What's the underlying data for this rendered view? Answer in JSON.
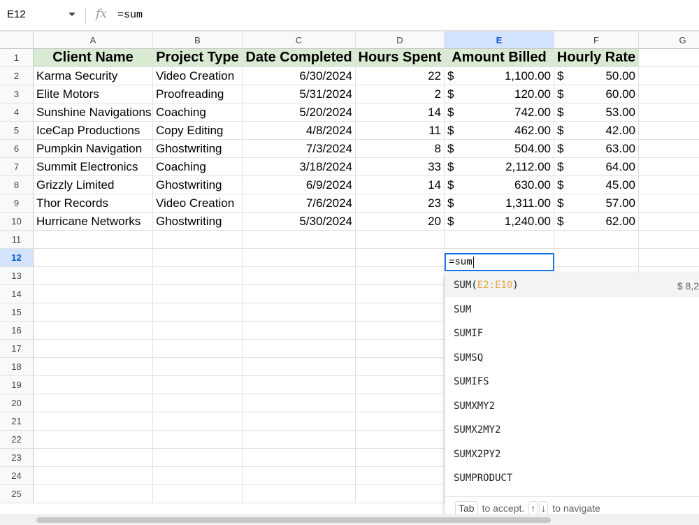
{
  "formula_bar": {
    "name_box": "E12",
    "fx_label": "fx",
    "formula": "=sum"
  },
  "columns": [
    "A",
    "B",
    "C",
    "D",
    "E",
    "F",
    "G"
  ],
  "rows": [
    "1",
    "2",
    "3",
    "4",
    "5",
    "6",
    "7",
    "8",
    "9",
    "10",
    "11",
    "12",
    "13",
    "14",
    "15",
    "16",
    "17",
    "18",
    "19",
    "20",
    "21",
    "22",
    "23",
    "24",
    "25"
  ],
  "selected_column": "E",
  "selected_row": "12",
  "table": {
    "headers": [
      "Client Name",
      "Project Type",
      "Date Completed",
      "Hours Spent",
      "Amount Billed",
      "Hourly Rate"
    ],
    "currency_symbol": "$",
    "rows": [
      [
        "Karma Security",
        "Video Creation",
        "6/30/2024",
        "22",
        "1,100.00",
        "50.00"
      ],
      [
        "Elite Motors",
        "Proofreading",
        "5/31/2024",
        "2",
        "120.00",
        "60.00"
      ],
      [
        "Sunshine Navigations",
        "Coaching",
        "5/20/2024",
        "14",
        "742.00",
        "53.00"
      ],
      [
        "IceCap Productions",
        "Copy Editing",
        "4/8/2024",
        "11",
        "462.00",
        "42.00"
      ],
      [
        "Pumpkin Navigation",
        "Ghostwriting",
        "7/3/2024",
        "8",
        "504.00",
        "63.00"
      ],
      [
        "Summit Electronics",
        "Coaching",
        "3/18/2024",
        "33",
        "2,112.00",
        "64.00"
      ],
      [
        "Grizzly Limited",
        "Ghostwriting",
        "6/9/2024",
        "14",
        "630.00",
        "45.00"
      ],
      [
        "Thor Records",
        "Video Creation",
        "7/6/2024",
        "23",
        "1,311.00",
        "57.00"
      ],
      [
        "Hurricane Networks",
        "Ghostwriting",
        "5/30/2024",
        "20",
        "1,240.00",
        "62.00"
      ]
    ]
  },
  "active_cell": {
    "ref": "E12",
    "value": "=sum"
  },
  "autocomplete": {
    "first": {
      "fn": "SUM(",
      "range": "E2:E10",
      "close": ")",
      "preview": "$ 8,2"
    },
    "items": [
      "SUM",
      "SUMIF",
      "SUMSQ",
      "SUMIFS",
      "SUMXMY2",
      "SUMX2MY2",
      "SUMX2PY2",
      "SUMPRODUCT"
    ],
    "footer": {
      "tab_key": "Tab",
      "accept_text": "to accept.",
      "up_key": "↑",
      "down_key": "↓",
      "navigate_text": "to navigate"
    }
  },
  "colors": {
    "header_fill": "#d9ead3",
    "selection_blue": "#1a73e8",
    "selected_header": "#d3e3fd"
  }
}
